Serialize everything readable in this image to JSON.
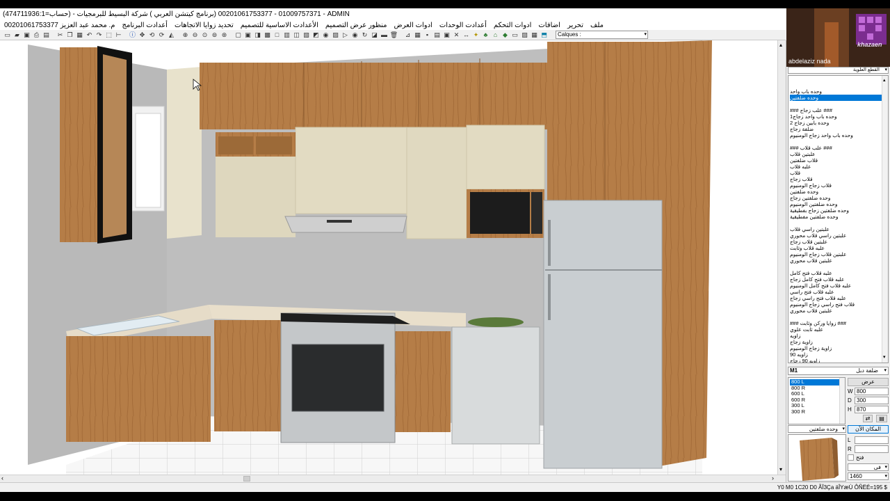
{
  "window": {
    "title": "(474711936:1=حساب) - 01009757371 - 00201061753377 (برنامج كيتشن العربي ) شركة البسيط للبرمجيات - ADMIN"
  },
  "menu": {
    "items": [
      "ملف",
      "تحرير",
      "اضافات",
      "ادوات التحكم",
      "أعدادت الوحدات",
      "ادوات العرض",
      "منظور عرض التصميم",
      "الأعدادت الاساسية للتصميم",
      "تحديد زوايا الاتجاهات",
      "أعدادت البرنامج",
      "م. محمد عبد العزيز 00201061753377"
    ]
  },
  "toolbar": {
    "calques_label": "Calques :"
  },
  "webcam": {
    "name": "abdelaziz nada",
    "logo_text": "khazaen"
  },
  "catalog": {
    "category": "القطع العلوية",
    "items": [
      "وحده باب واحد",
      "وحده ضلفتين",
      "",
      "### علب زجاج ###",
      "وحده باب واحد زجاج1",
      "وحده بابين زجاج 2",
      "ضلفة زجاج",
      "وحده باب واحد زجاج الومنيوم",
      "",
      "### علب قلاب ###",
      "علبتين قلاب",
      "قلاب ضلفتين",
      "علبه قلاب",
      "قلاب",
      "قلاب زجاج",
      "قلاب زجاج الومنيوم",
      "وحده ضلفتين",
      "وحده ضلفتين زجاج",
      "وحده ضلفتين الومنيوم",
      "وحده ضلفتين زجاج بفطيقية",
      "وحده ضلفتين مفطيقية",
      "",
      "علبتين راسي قلاب",
      "علبتين راسي قلاب محوري",
      "علبتين قلاب زجاج",
      "علبه قلاب وثابت",
      "علبتين قلاب زجاج الومنيوم",
      "علبتين قلاب محوري",
      "",
      "علبه قلاب فتح كامل",
      "علبه قلاب فتح كامل زجاج",
      "علبه قلاب فتح كامل الومنيوم",
      "علبه قلاب فتح راسي",
      "علبه قلاب فتح راسي زجاج",
      "قلاب فتح راسي زجاج الومنيوم",
      "علبتين قلاب محوري",
      "",
      "### زوايا وركن وثابت ###",
      "علبه ثابت علوي",
      "زاويه",
      "زاوية زجاج",
      "زاوية زجاج الومنيوم",
      "زاويه 90",
      "زاويه 90 زجاج",
      "زاويه 90 الومنيوم زجاج"
    ],
    "selected_index": 1
  },
  "sizes": {
    "model_code": "M1",
    "model_name": "ضلفة دبل",
    "list": [
      "800 L",
      "800 R",
      "600 L",
      "600 R",
      "300 L",
      "300 R"
    ],
    "selected_index": 0,
    "width_button": "عرض",
    "w_label": "W",
    "w_value": "800",
    "d_label": "D",
    "d_value": "300",
    "h_label": "H",
    "h_value": "870",
    "place_button": "المكان الآن",
    "variant": "وحده ضلفتين",
    "l_label": "L",
    "r_label": "R",
    "open_label": "فتح",
    "option_label": "فى",
    "value_1460": "1460"
  },
  "status": {
    "text": "Y0 M0 1C20 D0 ÃÎ3Ça äÎYæÙ ÔÑËÉ=195 $"
  },
  "colors": {
    "selection": "#0078d7",
    "wood": "#b07a45",
    "cream": "#ddd6bd"
  }
}
